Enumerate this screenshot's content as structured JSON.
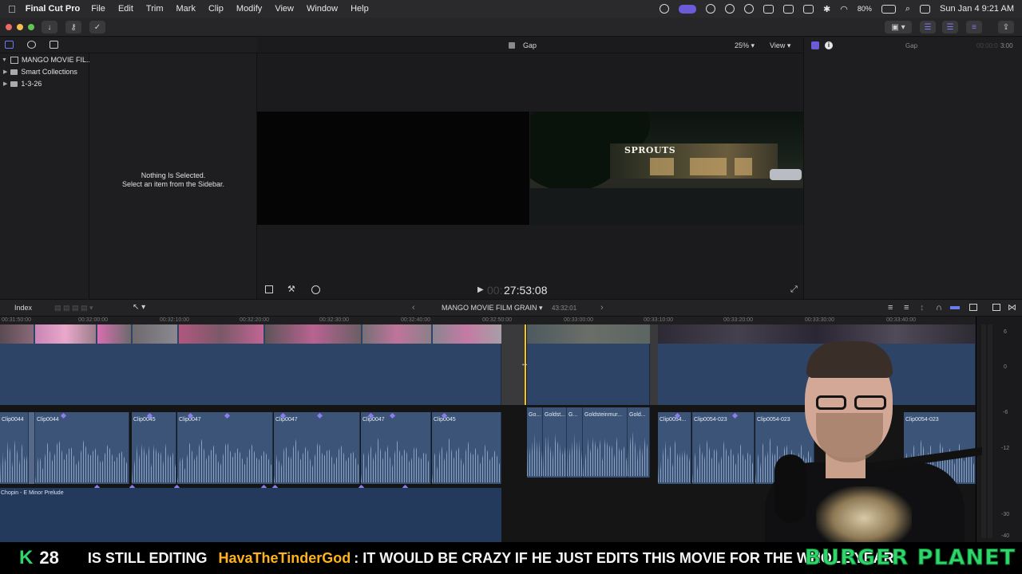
{
  "menubar": {
    "app_name": "Final Cut Pro",
    "menus": [
      "File",
      "Edit",
      "Trim",
      "Mark",
      "Clip",
      "Modify",
      "View",
      "Window",
      "Help"
    ],
    "battery": "80%",
    "clock": "Sun Jan 4  9:21 AM"
  },
  "library": {
    "name": "MANGO MOVIE FIL...",
    "items": [
      {
        "label": "Smart Collections",
        "icon": "folder-icon"
      },
      {
        "label": "1-3-26",
        "icon": "event-icon"
      }
    ]
  },
  "browser": {
    "empty_title": "Nothing Is Selected.",
    "empty_hint": "Select an item from the Sidebar."
  },
  "viewer": {
    "clip_name": "Gap",
    "zoom": "25%",
    "view_menu": "View",
    "timecode": "27:53:08",
    "timecode_prefix": "00:"
  },
  "inspector": {
    "title": "Gap",
    "duration": "3:00",
    "duration_prefix": "00:00:0"
  },
  "timeline": {
    "index_label": "Index",
    "project_name": "MANGO MOVIE FILM GRAIN",
    "project_duration": "43:32:01",
    "ruler": [
      "00:31:50:00",
      "00:32:00:00",
      "00:32:10:00",
      "00:32:20:00",
      "00:32:30:00",
      "00:32:40:00",
      "00:32:50:00",
      "00:33:00:00",
      "00:33:10:00",
      "00:33:20:00",
      "00:33:30:00",
      "00:33:40:00"
    ],
    "audio_clips": [
      "Clip0044",
      "Clip0044",
      "Clip0045",
      "Clip0047",
      "Clip0047",
      "Clip0047",
      "Clip0045",
      "Go...",
      "Goldst...",
      "G...",
      "Goldsteinmur...",
      "Gold...",
      "Clip0054...",
      "Clip0054-023",
      "Clip0054-023",
      "Clip0054-023"
    ],
    "music_clip": "Chopin - E Minor Prelude",
    "meter_scale": [
      "6",
      "0",
      "-6",
      "-12",
      "-30",
      "-40"
    ]
  },
  "ticker": {
    "k_letter": "K",
    "k_count": "28",
    "text1": "IS STILL EDITING",
    "username": "HavaTheTinderGod",
    "text2": ": IT WOULD BE CRAZY IF HE JUST EDITS THIS MOVIE FOR THE WHOLE YEAR",
    "brand": "BURGER PLANET"
  },
  "colors": {
    "accent": "#6b5bd6",
    "clip_blue": "#2d4466",
    "audio_blue": "#3b5478",
    "playhead": "#f5c518",
    "ticker_green": "#2fd66a",
    "ticker_orange": "#ffb21a"
  }
}
